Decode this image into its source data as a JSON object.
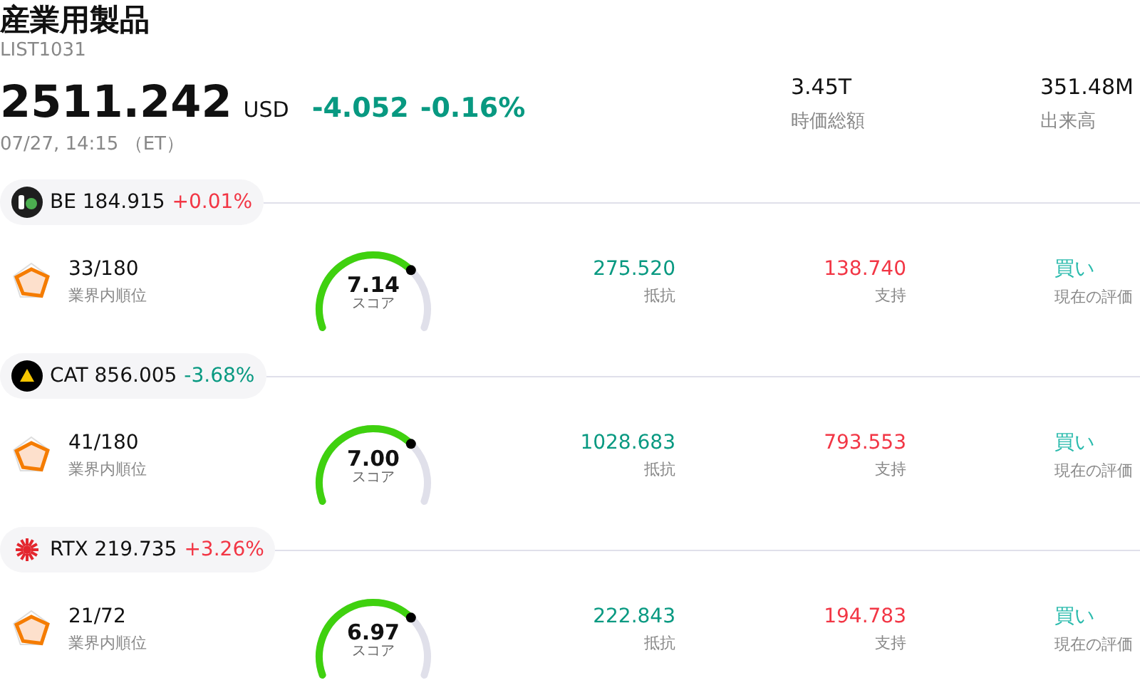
{
  "header": {
    "title": "産業用製品",
    "code": "LIST1031",
    "price": "2511.242",
    "currency": "USD",
    "change": "-4.052",
    "change_pct": "-0.16%",
    "color": "#089981",
    "time": "07/27, 14:15 （ET）"
  },
  "stats": [
    {
      "value": "3.45T",
      "label": "時価総額"
    },
    {
      "value": "351.48M",
      "label": "出来高"
    }
  ],
  "stocks": [
    {
      "kind": "dark",
      "ticker": "BE 184.915",
      "change": "+0.01%",
      "color": "#f23645",
      "rank": "33/180",
      "rank_label": "業界内順位",
      "score": "7.14",
      "score_label": "スコア",
      "resistance": "275.520",
      "resistance_label": "抵抗",
      "support": "138.740",
      "support_label": "支持",
      "rating": "買い",
      "rating_label": "現在の評価"
    },
    {
      "kind": "cat",
      "ticker": "CAT 856.005",
      "change": "-3.68%",
      "color": "#089981",
      "rank": "41/180",
      "rank_label": "業界内順位",
      "score": "7.00",
      "score_label": "スコア",
      "resistance": "1028.683",
      "resistance_label": "抵抗",
      "support": "793.553",
      "support_label": "支持",
      "rating": "買い",
      "rating_label": "現在の評価"
    },
    {
      "kind": "burst",
      "ticker": "RTX 219.735",
      "change": "+3.26%",
      "color": "#f23645",
      "rank": "21/72",
      "rank_label": "業界内順位",
      "score": "6.97",
      "score_label": "スコア",
      "resistance": "222.843",
      "resistance_label": "抵抗",
      "support": "194.783",
      "support_label": "支持",
      "rating": "買い",
      "rating_label": "現在の評価"
    }
  ]
}
